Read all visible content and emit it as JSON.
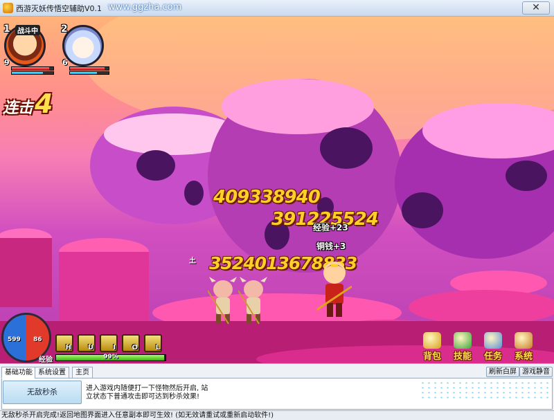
{
  "window": {
    "title": "西游灭妖传悟空辅助V0.1",
    "url_text": "www.ggzha.com",
    "close_label": "✕"
  },
  "game": {
    "party": [
      {
        "slot": "1",
        "status": "战斗中",
        "level": "9",
        "hp": 0.9,
        "mp": 0.75
      },
      {
        "slot": "2",
        "level": "6",
        "hp": 0.9,
        "mp": 0.7
      }
    ],
    "combo": {
      "label": "连击",
      "count": "4"
    },
    "damage_numbers": [
      "409338940",
      "391225524",
      "3524013678833"
    ],
    "gains": {
      "exp": "经验+23",
      "copper": "铜钱+3"
    },
    "ground_marker": "土",
    "hud": {
      "hp_value": "599",
      "mp_value": "86",
      "skill_keys": [
        "H",
        "U",
        "I",
        "O",
        "L"
      ],
      "exp_label": "经验",
      "exp_percent": "99%",
      "exp_fraction": 0.99
    },
    "menu": [
      {
        "label": "背包",
        "icon": "backpack-icon",
        "color": "#d8a01a"
      },
      {
        "label": "技能",
        "icon": "skill-book-icon",
        "color": "#3aa53a"
      },
      {
        "label": "任务",
        "icon": "quest-scroll-icon",
        "color": "#5a8fd8"
      },
      {
        "label": "系统",
        "icon": "gear-icon",
        "color": "#c87a2a"
      }
    ]
  },
  "panel": {
    "tabs": [
      "基础功能",
      "系统设置",
      "主页"
    ],
    "active_tab": 0,
    "invincible_button": "无敌秒杀",
    "description_line1": "进入游戏内随便打一下怪物然后开启, 站",
    "description_line2": "立状态下普通攻击即可达到秒杀效果!",
    "refresh_button": "刷新白屏",
    "mute_button": "游戏静音"
  },
  "status_bar": "无敌秒杀开启完成!返回地图界面进入任意副本即可生效! (如无效请重试或重新启动软件!)"
}
